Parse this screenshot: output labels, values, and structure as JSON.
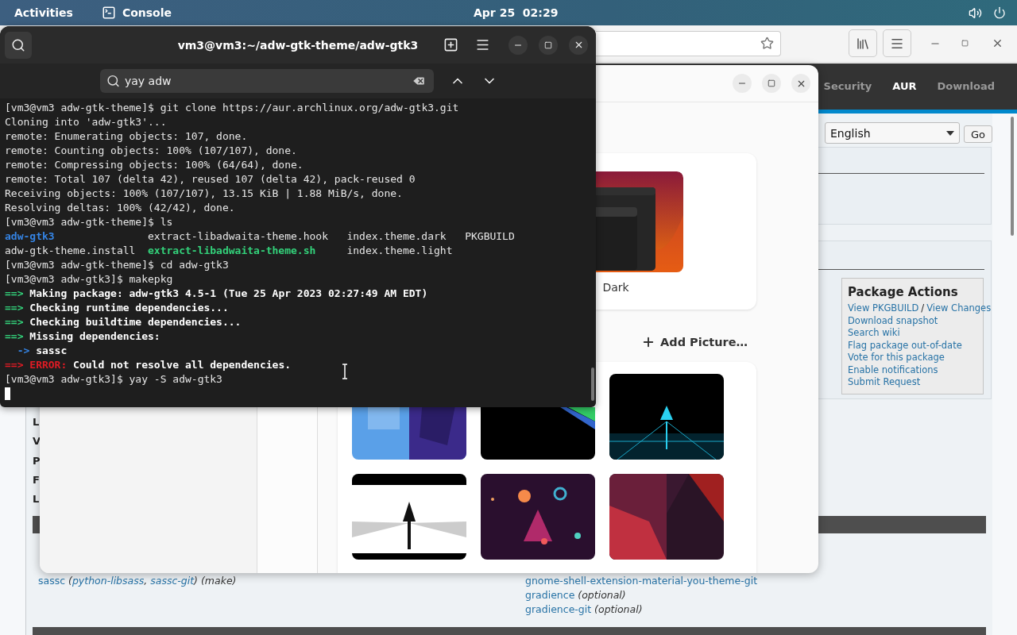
{
  "top_bar": {
    "activities": "Activities",
    "app": "Console",
    "clock": "Apr 25  02:29"
  },
  "browser": {
    "nav": [
      {
        "label": "Security",
        "selected": false
      },
      {
        "label": "AUR",
        "selected": true
      },
      {
        "label": "Download",
        "selected": false
      }
    ],
    "language_select": {
      "value": "English"
    },
    "go_button": "Go",
    "package_actions": {
      "title": "Package Actions",
      "separator": "/",
      "rows": [
        [
          "View PKGBUILD",
          "View Changes"
        ],
        [
          "Download snapshot"
        ],
        [
          "Search wiki"
        ],
        [
          "Flag package out-of-date"
        ],
        [
          "Vote for this package"
        ],
        [
          "Enable notifications"
        ],
        [
          "Submit Request"
        ]
      ]
    },
    "cut_labels": [
      "L",
      "V",
      "P",
      "F",
      "L"
    ],
    "dependencies_left": [
      [
        {
          "text": "sassc",
          "kind": "link"
        },
        {
          "text": " (",
          "kind": "note"
        },
        {
          "text": "python-libsass",
          "kind": "alt-link"
        },
        {
          "text": ", ",
          "kind": "note"
        },
        {
          "text": "sassc-git",
          "kind": "alt-link"
        },
        {
          "text": ") (make)",
          "kind": "note"
        }
      ]
    ],
    "dependencies_right": [
      [
        {
          "text": "gnome-shell-extension-material-you-theme-git",
          "kind": "link"
        }
      ],
      [
        {
          "text": "gradience",
          "kind": "link"
        },
        {
          "text": " (optional)",
          "kind": "note"
        }
      ],
      [
        {
          "text": "gradience-git",
          "kind": "link"
        },
        {
          "text": " (optional)",
          "kind": "note"
        }
      ]
    ]
  },
  "settings": {
    "theme_option": {
      "label": "Dark"
    },
    "add_picture": "Add Picture…"
  },
  "terminal": {
    "title": "vm3@vm3:~/adw-gtk-theme/adw-gtk3",
    "search": {
      "value": "yay adw"
    },
    "lines": [
      {
        "kind": "text",
        "segments": [
          {
            "text": "[vm3@vm3 adw-gtk-theme]$ git clone https://aur.archlinux.org/adw-gtk3.git",
            "kind": "plain"
          }
        ]
      },
      {
        "kind": "text",
        "segments": [
          {
            "text": "Cloning into 'adw-gtk3'...",
            "kind": "plain"
          }
        ]
      },
      {
        "kind": "text",
        "segments": [
          {
            "text": "remote: Enumerating objects: 107, done.",
            "kind": "plain"
          }
        ]
      },
      {
        "kind": "text",
        "segments": [
          {
            "text": "remote: Counting objects: 100% (107/107), done.",
            "kind": "plain"
          }
        ]
      },
      {
        "kind": "text",
        "segments": [
          {
            "text": "remote: Compressing objects: 100% (64/64), done.",
            "kind": "plain"
          }
        ]
      },
      {
        "kind": "text",
        "segments": [
          {
            "text": "remote: Total 107 (delta 42), reused 107 (delta 42), pack-reused 0",
            "kind": "plain"
          }
        ]
      },
      {
        "kind": "text",
        "segments": [
          {
            "text": "Receiving objects: 100% (107/107), 13.15 KiB | 1.88 MiB/s, done.",
            "kind": "plain"
          }
        ]
      },
      {
        "kind": "text",
        "segments": [
          {
            "text": "Resolving deltas: 100% (42/42), done.",
            "kind": "plain"
          }
        ]
      },
      {
        "kind": "text",
        "segments": [
          {
            "text": "[vm3@vm3 adw-gtk-theme]$ ls",
            "kind": "plain"
          }
        ]
      },
      {
        "kind": "columns",
        "cells": [
          {
            "text": "adw-gtk3",
            "kind": "directory"
          },
          {
            "text": "extract-libadwaita-theme.hook",
            "kind": "file"
          },
          {
            "text": "index.theme.dark",
            "kind": "file"
          },
          {
            "text": "PKGBUILD",
            "kind": "file"
          }
        ]
      },
      {
        "kind": "columns",
        "cells": [
          {
            "text": "adw-gtk-theme.install",
            "kind": "file"
          },
          {
            "text": "extract-libadwaita-theme.sh",
            "kind": "executable"
          },
          {
            "text": "index.theme.light",
            "kind": "file"
          }
        ]
      },
      {
        "kind": "text",
        "segments": [
          {
            "text": "[vm3@vm3 adw-gtk-theme]$ cd adw-gtk3",
            "kind": "plain"
          }
        ]
      },
      {
        "kind": "text",
        "segments": [
          {
            "text": "[vm3@vm3 adw-gtk3]$ makepkg",
            "kind": "plain"
          }
        ]
      },
      {
        "kind": "text",
        "segments": [
          {
            "text": "==> ",
            "kind": "arrow"
          },
          {
            "text": "Making package: adw-gtk3 4.5-1 (Tue 25 Apr 2023 02:27:49 AM EDT)",
            "kind": "message"
          }
        ]
      },
      {
        "kind": "text",
        "segments": [
          {
            "text": "==> ",
            "kind": "arrow"
          },
          {
            "text": "Checking runtime dependencies...",
            "kind": "message"
          }
        ]
      },
      {
        "kind": "text",
        "segments": [
          {
            "text": "==> ",
            "kind": "arrow"
          },
          {
            "text": "Checking buildtime dependencies...",
            "kind": "message"
          }
        ]
      },
      {
        "kind": "text",
        "segments": [
          {
            "text": "==> ",
            "kind": "arrow"
          },
          {
            "text": "Missing dependencies:",
            "kind": "message"
          }
        ]
      },
      {
        "kind": "text",
        "segments": [
          {
            "text": "  -> ",
            "kind": "sub-arrow"
          },
          {
            "text": "sassc",
            "kind": "message"
          }
        ]
      },
      {
        "kind": "text",
        "segments": [
          {
            "text": "==> ERROR:",
            "kind": "error"
          },
          {
            "text": " Could not resolve all dependencies.",
            "kind": "message"
          }
        ]
      },
      {
        "kind": "text",
        "segments": [
          {
            "text": "[vm3@vm3 adw-gtk3]$ yay -S adw-gtk3",
            "kind": "plain"
          }
        ]
      }
    ]
  }
}
